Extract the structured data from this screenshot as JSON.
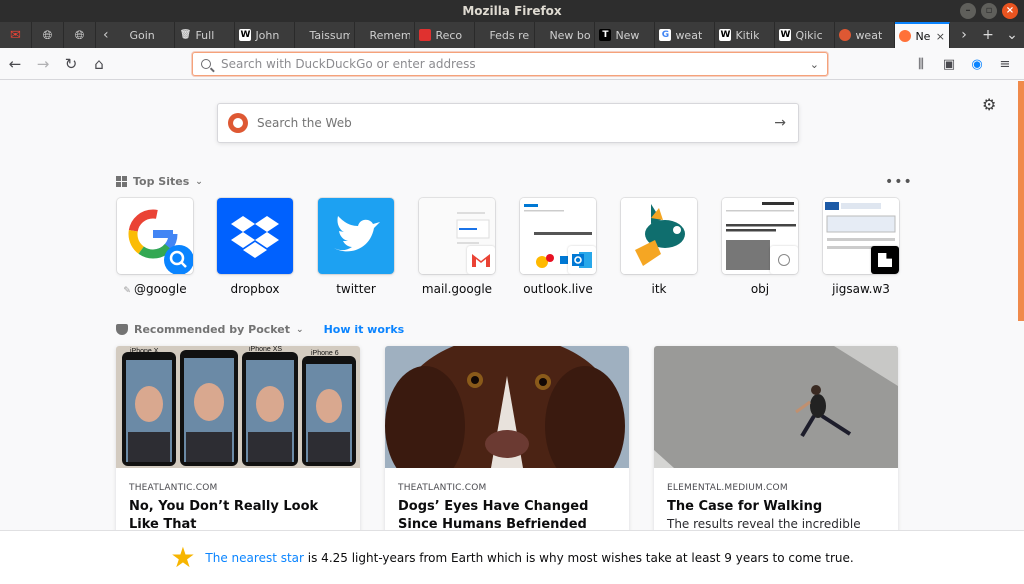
{
  "window": {
    "title": "Mozilla Firefox"
  },
  "tabs": [
    {
      "label": "Goin",
      "icon": "tab-blank-icon"
    },
    {
      "label": "Full",
      "icon": "trash-favicon-icon"
    },
    {
      "label": "John",
      "icon": "wikipedia-icon"
    },
    {
      "label": "Taissum",
      "icon": "tab-blank-icon"
    },
    {
      "label": "Remem",
      "icon": "tab-blank-icon"
    },
    {
      "label": "Reco",
      "icon": "red-favicon-icon"
    },
    {
      "label": "Feds re",
      "icon": "tab-blank-icon"
    },
    {
      "label": "New bo",
      "icon": "tab-blank-icon"
    },
    {
      "label": "New",
      "icon": "t-favicon-icon"
    },
    {
      "label": "weat",
      "icon": "google-icon"
    },
    {
      "label": "Kitik",
      "icon": "wikipedia-icon"
    },
    {
      "label": "Qikic",
      "icon": "wikipedia-icon"
    },
    {
      "label": "weat",
      "icon": "duckduckgo-icon"
    }
  ],
  "active_tab": {
    "label": "Ne",
    "icon": "firefox-icon"
  },
  "urlbar": {
    "placeholder": "Search with DuckDuckGo or enter address"
  },
  "search": {
    "placeholder": "Search the Web"
  },
  "top_sites": {
    "heading": "Top Sites",
    "sites": [
      {
        "label": "@google"
      },
      {
        "label": "dropbox"
      },
      {
        "label": "twitter"
      },
      {
        "label": "mail.google"
      },
      {
        "label": "outlook.live"
      },
      {
        "label": "itk"
      },
      {
        "label": "obj"
      },
      {
        "label": "jigsaw.w3"
      }
    ]
  },
  "pocket": {
    "heading": "Recommended by Pocket",
    "link": "How it works",
    "cards": [
      {
        "source": "THEATLANTIC.COM",
        "title": "No, You Don’t Really Look Like That",
        "desc": ""
      },
      {
        "source": "THEATLANTIC.COM",
        "title": "Dogs’ Eyes Have Changed Since Humans Befriended Them",
        "desc": ""
      },
      {
        "source": "ELEMENTAL.MEDIUM.COM",
        "title": "The Case for Walking",
        "desc": "The results reveal the incredible power"
      }
    ]
  },
  "image_text": {
    "iphone_x": "iPhone X",
    "iphone_xs": "iPhone XS",
    "iphone_6": "iPhone 6"
  },
  "snippet": {
    "link": "The nearest star",
    "text": " is 4.25 light-years from Earth which is why most wishes take at least 9 years to come true."
  },
  "colors": {
    "accent": "#0a84ff",
    "ubuntu_orange": "#e95420",
    "dropbox": "#0061fe",
    "twitter": "#1da1f2"
  }
}
